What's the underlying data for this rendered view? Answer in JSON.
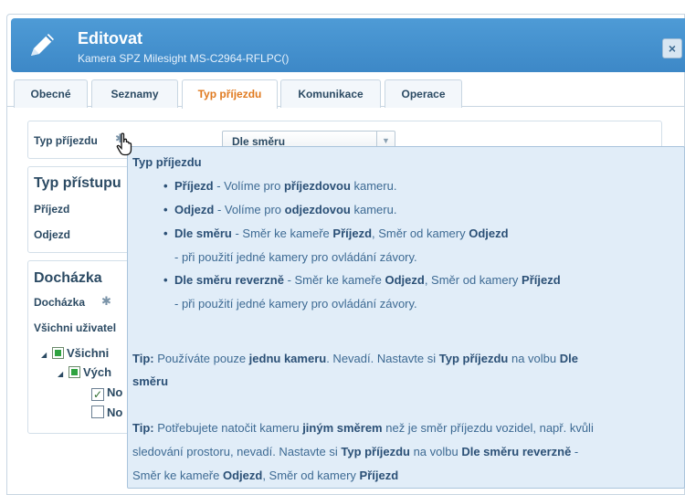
{
  "dialog": {
    "title": "Editovat",
    "subtitle": "Kamera SPZ Milesight MS-C2964-RFLPC()",
    "close_label": "×"
  },
  "tabs": [
    {
      "label": "Obecné",
      "active": false
    },
    {
      "label": "Seznamy",
      "active": false
    },
    {
      "label": "Typ příjezdu",
      "active": true
    },
    {
      "label": "Komunikace",
      "active": false
    },
    {
      "label": "Operace",
      "active": false
    }
  ],
  "arrival": {
    "label": "Typ příjezdu",
    "select_value": "Dle směru",
    "select_arrow": "▼"
  },
  "access": {
    "heading": "Typ přístupu",
    "row1": "Příjezd",
    "row2": "Odjezd"
  },
  "attendance": {
    "heading": "Docházka",
    "label": "Docházka",
    "all_users": "Všichni uživatel",
    "tree": [
      "Všichni",
      "Vých",
      "No",
      "No"
    ]
  },
  "tooltip": {
    "title": "Typ příjezdu",
    "b1_bold": "Příjezd",
    "b1_text1": " - Volíme pro ",
    "b1_bold2": "příjezdovou",
    "b1_text2": " kameru.",
    "b2_bold": "Odjezd",
    "b2_text1": " - Volíme pro ",
    "b2_bold2": "odjezdovou",
    "b2_text2": " kameru.",
    "b3_bold": "Dle směru",
    "b3_text1": " - Směr ke kameře ",
    "b3_bold2": "Příjezd",
    "b3_text2": ", Směr od kamery ",
    "b3_bold3": "Odjezd",
    "b3_note": "- při použití jedné kamery pro ovládání závory.",
    "b4_bold": "Dle směru reverzně",
    "b4_text1": " - Směr ke kameře ",
    "b4_bold2": "Odjezd",
    "b4_text2": ", Směr od kamery ",
    "b4_bold3": "Příjezd",
    "b4_note": "- při použití jedné kamery pro ovládání závory.",
    "tip1_label": "Tip:",
    "tip1_t1": " Používáte pouze ",
    "tip1_b1": "jednu kameru",
    "tip1_t2": ". Nevadí. Nastavte si ",
    "tip1_b2": "Typ příjezdu",
    "tip1_t3": " na volbu ",
    "tip1_b3": "Dle",
    "tip1_b4": "směru",
    "tip2_label": "Tip:",
    "tip2_t1": " Potřebujete natočit kameru ",
    "tip2_b1": "jiným směrem",
    "tip2_t2": " než je směr příjezdu vozidel, např. kvůli",
    "tip2_line2_t1": "sledování prostoru, nevadí. Nastavte si ",
    "tip2_b2": "Typ příjezdu",
    "tip2_line2_t2": " na volbu ",
    "tip2_b3": "Dle směru reverzně",
    "tip2_line2_t3": " -",
    "tip2_line3_t1": "Směr ke kameře ",
    "tip2_b4": "Odjezd",
    "tip2_line3_t2": ", Směr od kamery ",
    "tip2_b5": "Příjezd"
  },
  "icons": {
    "title": "pencil-icon",
    "gear": "gear-icon",
    "cursor": "hand-pointer-icon"
  },
  "colors": {
    "titlebar": "#3d88c7",
    "active_tab": "#e07a1f",
    "tooltip_bg": "#e1edf8"
  }
}
